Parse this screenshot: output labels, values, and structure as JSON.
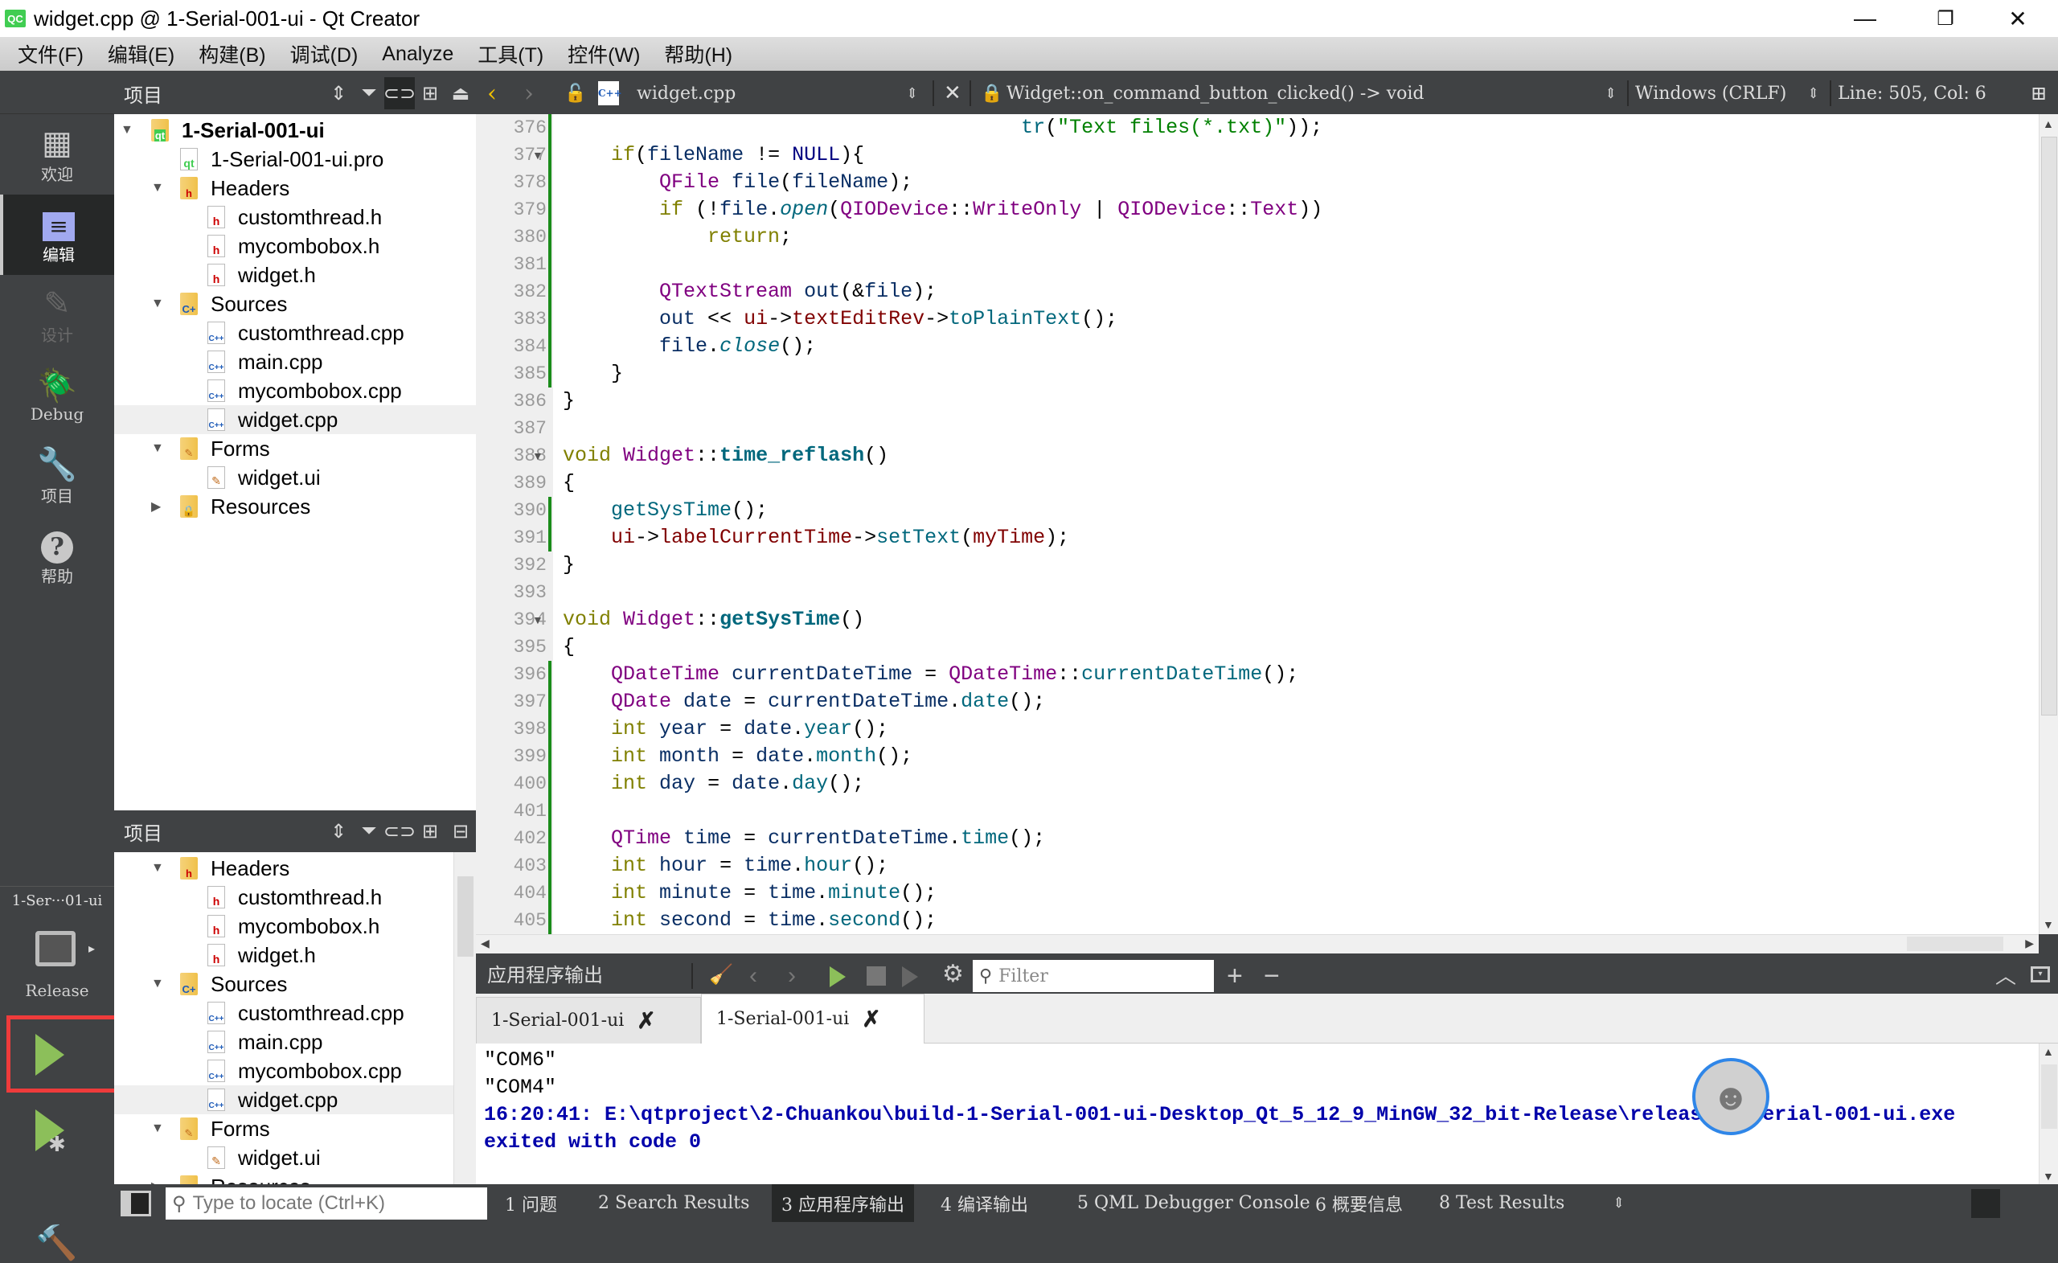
{
  "window": {
    "title": "widget.cpp @ 1-Serial-001-ui - Qt Creator",
    "app_icon": "QC"
  },
  "menu": [
    "文件(F)",
    "编辑(E)",
    "构建(B)",
    "调试(D)",
    "Analyze",
    "工具(T)",
    "控件(W)",
    "帮助(H)"
  ],
  "modes": [
    {
      "label": "欢迎",
      "icon": "welcome-grid-icon"
    },
    {
      "label": "编辑",
      "icon": "edit-icon",
      "active": true
    },
    {
      "label": "设计",
      "icon": "design-pencil-icon",
      "disabled": true
    },
    {
      "label": "Debug",
      "icon": "debug-bug-icon"
    },
    {
      "label": "项目",
      "icon": "projects-wrench-icon"
    },
    {
      "label": "帮助",
      "icon": "help-icon"
    }
  ],
  "kit": {
    "project": "1-Ser···01-ui",
    "build": "Release"
  },
  "project_pane": {
    "title": "项目",
    "tree": [
      {
        "label": "1-Serial-001-ui",
        "level": 0,
        "type": "project",
        "expanded": true,
        "bold": true
      },
      {
        "label": "1-Serial-001-ui.pro",
        "level": 1,
        "type": "pro"
      },
      {
        "label": "Headers",
        "level": 1,
        "type": "folder-h",
        "expanded": true
      },
      {
        "label": "customthread.h",
        "level": 2,
        "type": "h"
      },
      {
        "label": "mycombobox.h",
        "level": 2,
        "type": "h"
      },
      {
        "label": "widget.h",
        "level": 2,
        "type": "h"
      },
      {
        "label": "Sources",
        "level": 1,
        "type": "folder-cpp",
        "expanded": true
      },
      {
        "label": "customthread.cpp",
        "level": 2,
        "type": "cpp"
      },
      {
        "label": "main.cpp",
        "level": 2,
        "type": "cpp"
      },
      {
        "label": "mycombobox.cpp",
        "level": 2,
        "type": "cpp"
      },
      {
        "label": "widget.cpp",
        "level": 2,
        "type": "cpp",
        "selected": true
      },
      {
        "label": "Forms",
        "level": 1,
        "type": "folder-ui",
        "expanded": true
      },
      {
        "label": "widget.ui",
        "level": 2,
        "type": "ui"
      },
      {
        "label": "Resources",
        "level": 1,
        "type": "folder-res",
        "expanded": false
      }
    ]
  },
  "project_pane2": {
    "title": "项目",
    "tree": [
      {
        "label": "Headers",
        "level": 1,
        "type": "folder-h",
        "expanded": true
      },
      {
        "label": "customthread.h",
        "level": 2,
        "type": "h"
      },
      {
        "label": "mycombobox.h",
        "level": 2,
        "type": "h"
      },
      {
        "label": "widget.h",
        "level": 2,
        "type": "h"
      },
      {
        "label": "Sources",
        "level": 1,
        "type": "folder-cpp",
        "expanded": true
      },
      {
        "label": "customthread.cpp",
        "level": 2,
        "type": "cpp"
      },
      {
        "label": "main.cpp",
        "level": 2,
        "type": "cpp"
      },
      {
        "label": "mycombobox.cpp",
        "level": 2,
        "type": "cpp"
      },
      {
        "label": "widget.cpp",
        "level": 2,
        "type": "cpp",
        "selected": true
      },
      {
        "label": "Forms",
        "level": 1,
        "type": "folder-ui",
        "expanded": true
      },
      {
        "label": "widget.ui",
        "level": 2,
        "type": "ui"
      },
      {
        "label": "Resources",
        "level": 1,
        "type": "folder-res",
        "expanded": false
      }
    ]
  },
  "editor": {
    "file": "widget.cpp",
    "symbol": "Widget::on_command_button_clicked() -> void",
    "line_ending": "Windows (CRLF)",
    "position": "Line: 505, Col: 6",
    "lines": [
      {
        "n": 376,
        "indent": 0,
        "tokens": [
          [
            "                                      ",
            "p"
          ],
          [
            "tr",
            "fn"
          ],
          [
            "(",
            "p"
          ],
          [
            "\"Text files(*.txt)\"",
            "str"
          ],
          [
            ")); ",
            "p"
          ]
        ],
        "changed": true
      },
      {
        "n": 377,
        "fold": true,
        "tokens": [
          [
            "    ",
            "p"
          ],
          [
            "if",
            "kw"
          ],
          [
            "(",
            "p"
          ],
          [
            "fileName",
            "var"
          ],
          [
            " != ",
            "p"
          ],
          [
            "NULL",
            "mac"
          ],
          [
            "){",
            "p"
          ]
        ],
        "changed": true
      },
      {
        "n": 378,
        "tokens": [
          [
            "        ",
            "p"
          ],
          [
            "QFile",
            "type"
          ],
          [
            " ",
            "p"
          ],
          [
            "file",
            "var"
          ],
          [
            "(",
            "p"
          ],
          [
            "fileName",
            "var"
          ],
          [
            ");",
            "p"
          ]
        ],
        "changed": true
      },
      {
        "n": 379,
        "tokens": [
          [
            "        ",
            "p"
          ],
          [
            "if",
            "kw"
          ],
          [
            " (!",
            "p"
          ],
          [
            "file",
            "var"
          ],
          [
            ".",
            "p"
          ],
          [
            "open",
            "vfn"
          ],
          [
            "(",
            "p"
          ],
          [
            "QIODevice",
            "type"
          ],
          [
            "::",
            "p"
          ],
          [
            "WriteOnly",
            "enum"
          ],
          [
            " | ",
            "p"
          ],
          [
            "QIODevice",
            "type"
          ],
          [
            "::",
            "p"
          ],
          [
            "Text",
            "enum"
          ],
          [
            "))",
            "p"
          ]
        ],
        "changed": true
      },
      {
        "n": 380,
        "tokens": [
          [
            "            ",
            "p"
          ],
          [
            "return",
            "kw"
          ],
          [
            ";",
            "p"
          ]
        ],
        "changed": true
      },
      {
        "n": 381,
        "tokens": [],
        "changed": true
      },
      {
        "n": 382,
        "tokens": [
          [
            "        ",
            "p"
          ],
          [
            "QTextStream",
            "type"
          ],
          [
            " ",
            "p"
          ],
          [
            "out",
            "var"
          ],
          [
            "(&",
            "p"
          ],
          [
            "file",
            "var"
          ],
          [
            ");",
            "p"
          ]
        ],
        "changed": true
      },
      {
        "n": 383,
        "tokens": [
          [
            "        ",
            "p"
          ],
          [
            "out",
            "var"
          ],
          [
            " << ",
            "p"
          ],
          [
            "ui",
            "mem"
          ],
          [
            "->",
            "p"
          ],
          [
            "textEditRev",
            "mem"
          ],
          [
            "->",
            "p"
          ],
          [
            "toPlainText",
            "fn"
          ],
          [
            "();",
            "p"
          ]
        ],
        "changed": true
      },
      {
        "n": 384,
        "tokens": [
          [
            "        ",
            "p"
          ],
          [
            "file",
            "var"
          ],
          [
            ".",
            "p"
          ],
          [
            "close",
            "vfn"
          ],
          [
            "();",
            "p"
          ]
        ],
        "changed": true
      },
      {
        "n": 385,
        "tokens": [
          [
            "    ",
            "p"
          ],
          [
            "}",
            "p"
          ]
        ],
        "changed": true
      },
      {
        "n": 386,
        "tokens": [
          [
            "}",
            "p"
          ]
        ]
      },
      {
        "n": 387,
        "tokens": []
      },
      {
        "n": 388,
        "fold": true,
        "tokens": [
          [
            "void",
            "kw"
          ],
          [
            " ",
            "p"
          ],
          [
            "Widget",
            "type"
          ],
          [
            "::",
            "p"
          ],
          [
            "time_reflash",
            "fnb"
          ],
          [
            "()",
            "p"
          ]
        ]
      },
      {
        "n": 389,
        "tokens": [
          [
            "{",
            "p"
          ]
        ]
      },
      {
        "n": 390,
        "tokens": [
          [
            "    ",
            "p"
          ],
          [
            "getSysTime",
            "fn"
          ],
          [
            "();",
            "p"
          ]
        ],
        "changed": true
      },
      {
        "n": 391,
        "tokens": [
          [
            "    ",
            "p"
          ],
          [
            "ui",
            "mem"
          ],
          [
            "->",
            "p"
          ],
          [
            "labelCurrentTime",
            "mem"
          ],
          [
            "->",
            "p"
          ],
          [
            "setText",
            "fn"
          ],
          [
            "(",
            "p"
          ],
          [
            "myTime",
            "mem"
          ],
          [
            ");",
            "p"
          ]
        ],
        "changed": true
      },
      {
        "n": 392,
        "tokens": [
          [
            "}",
            "p"
          ]
        ]
      },
      {
        "n": 393,
        "tokens": []
      },
      {
        "n": 394,
        "fold": true,
        "tokens": [
          [
            "void",
            "kw"
          ],
          [
            " ",
            "p"
          ],
          [
            "Widget",
            "type"
          ],
          [
            "::",
            "p"
          ],
          [
            "getSysTime",
            "fnb"
          ],
          [
            "()",
            "p"
          ]
        ]
      },
      {
        "n": 395,
        "tokens": [
          [
            "{",
            "p"
          ]
        ]
      },
      {
        "n": 396,
        "tokens": [
          [
            "    ",
            "p"
          ],
          [
            "QDateTime",
            "type"
          ],
          [
            " ",
            "p"
          ],
          [
            "currentDateTime",
            "var"
          ],
          [
            " = ",
            "p"
          ],
          [
            "QDateTime",
            "type"
          ],
          [
            "::",
            "p"
          ],
          [
            "currentDateTime",
            "fn"
          ],
          [
            "();",
            "p"
          ]
        ],
        "changed": true
      },
      {
        "n": 397,
        "tokens": [
          [
            "    ",
            "p"
          ],
          [
            "QDate",
            "type"
          ],
          [
            " ",
            "p"
          ],
          [
            "date",
            "var"
          ],
          [
            " = ",
            "p"
          ],
          [
            "currentDateTime",
            "var"
          ],
          [
            ".",
            "p"
          ],
          [
            "date",
            "fn"
          ],
          [
            "();",
            "p"
          ]
        ],
        "changed": true
      },
      {
        "n": 398,
        "tokens": [
          [
            "    ",
            "p"
          ],
          [
            "int",
            "kw"
          ],
          [
            " ",
            "p"
          ],
          [
            "year",
            "var"
          ],
          [
            " = ",
            "p"
          ],
          [
            "date",
            "var"
          ],
          [
            ".",
            "p"
          ],
          [
            "year",
            "fn"
          ],
          [
            "();",
            "p"
          ]
        ],
        "changed": true
      },
      {
        "n": 399,
        "tokens": [
          [
            "    ",
            "p"
          ],
          [
            "int",
            "kw"
          ],
          [
            " ",
            "p"
          ],
          [
            "month",
            "var"
          ],
          [
            " = ",
            "p"
          ],
          [
            "date",
            "var"
          ],
          [
            ".",
            "p"
          ],
          [
            "month",
            "fn"
          ],
          [
            "();",
            "p"
          ]
        ],
        "changed": true
      },
      {
        "n": 400,
        "tokens": [
          [
            "    ",
            "p"
          ],
          [
            "int",
            "kw"
          ],
          [
            " ",
            "p"
          ],
          [
            "day",
            "var"
          ],
          [
            " = ",
            "p"
          ],
          [
            "date",
            "var"
          ],
          [
            ".",
            "p"
          ],
          [
            "day",
            "fn"
          ],
          [
            "();",
            "p"
          ]
        ],
        "changed": true
      },
      {
        "n": 401,
        "tokens": [],
        "changed": true
      },
      {
        "n": 402,
        "tokens": [
          [
            "    ",
            "p"
          ],
          [
            "QTime",
            "type"
          ],
          [
            " ",
            "p"
          ],
          [
            "time",
            "var"
          ],
          [
            " = ",
            "p"
          ],
          [
            "currentDateTime",
            "var"
          ],
          [
            ".",
            "p"
          ],
          [
            "time",
            "fn"
          ],
          [
            "();",
            "p"
          ]
        ],
        "changed": true
      },
      {
        "n": 403,
        "tokens": [
          [
            "    ",
            "p"
          ],
          [
            "int",
            "kw"
          ],
          [
            " ",
            "p"
          ],
          [
            "hour",
            "var"
          ],
          [
            " = ",
            "p"
          ],
          [
            "time",
            "var"
          ],
          [
            ".",
            "p"
          ],
          [
            "hour",
            "fn"
          ],
          [
            "();",
            "p"
          ]
        ],
        "changed": true
      },
      {
        "n": 404,
        "tokens": [
          [
            "    ",
            "p"
          ],
          [
            "int",
            "kw"
          ],
          [
            " ",
            "p"
          ],
          [
            "minute",
            "var"
          ],
          [
            " = ",
            "p"
          ],
          [
            "time",
            "var"
          ],
          [
            ".",
            "p"
          ],
          [
            "minute",
            "fn"
          ],
          [
            "();",
            "p"
          ]
        ],
        "changed": true
      },
      {
        "n": 405,
        "tokens": [
          [
            "    ",
            "p"
          ],
          [
            "int",
            "kw"
          ],
          [
            " ",
            "p"
          ],
          [
            "second",
            "var"
          ],
          [
            " = ",
            "p"
          ],
          [
            "time",
            "var"
          ],
          [
            ".",
            "p"
          ],
          [
            "second",
            "fn"
          ],
          [
            "();",
            "p"
          ]
        ],
        "changed": true
      }
    ]
  },
  "syntax_colors": {
    "p": "#000000",
    "kw": "#808000",
    "type": "#800080",
    "var": "#092e64",
    "fn": "#00677c",
    "fnb": "#00677c",
    "vfn": "#00677c",
    "mem": "#800000",
    "str": "#008000",
    "mac": "#000080",
    "enum": "#800080"
  },
  "output_pane": {
    "title": "应用程序输出",
    "filter_placeholder": "Filter",
    "tabs": [
      {
        "label": "1-Serial-001-ui"
      },
      {
        "label": "1-Serial-001-ui",
        "active": true
      }
    ],
    "lines": [
      {
        "text": "\"COM6\"",
        "style": "normal"
      },
      {
        "text": "\"COM4\"",
        "style": "normal"
      },
      {
        "text": "16:20:41: E:\\qtproject\\2-Chuankou\\build-1-Serial-001-ui-Desktop_Qt_5_12_9_MinGW_32_bit-Release\\release\\1-Serial-001-ui.exe",
        "style": "info"
      },
      {
        "text": "exited with code 0",
        "style": "info"
      }
    ]
  },
  "status_bar": {
    "locator_placeholder": "Type to locate (Ctrl+K)",
    "panes": [
      {
        "label": "1  问题"
      },
      {
        "label": "2  Search Results"
      },
      {
        "label": "3  应用程序输出",
        "active": true
      },
      {
        "label": "4  编译输出"
      },
      {
        "label": "5  QML Debugger Console"
      },
      {
        "label": "6  概要信息"
      },
      {
        "label": "8  Test Results"
      }
    ]
  },
  "accent": {
    "run_green": "#8cbf5a",
    "highlight_box": "#ef3b3b",
    "active_edit": "#a1a9ef"
  }
}
